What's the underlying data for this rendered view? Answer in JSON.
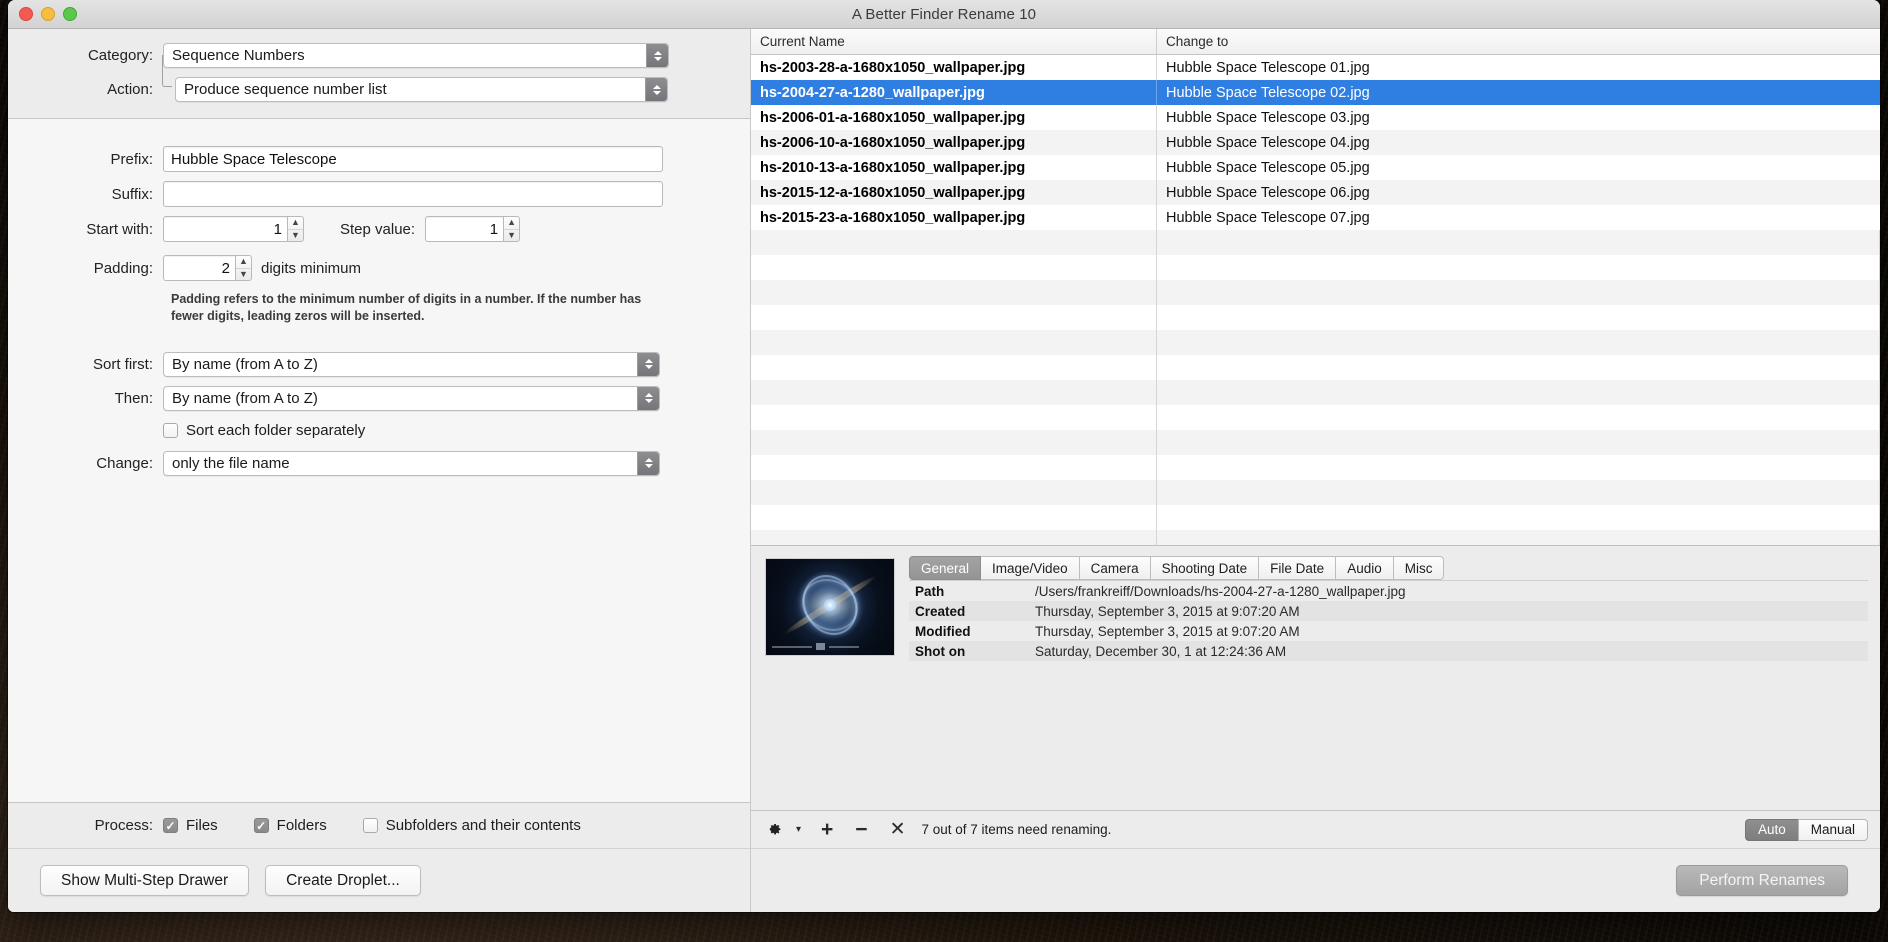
{
  "window": {
    "title": "A Better Finder Rename 10",
    "traffic": {
      "close": "close-button",
      "minimize": "minimize-button",
      "zoom": "zoom-button"
    }
  },
  "form": {
    "category_label": "Category:",
    "category_value": "Sequence Numbers",
    "action_label": "Action:",
    "action_value": "Produce sequence number list",
    "prefix_label": "Prefix:",
    "prefix_value": "Hubble Space Telescope",
    "prefix_placeholder": "",
    "suffix_label": "Suffix:",
    "suffix_value": "",
    "suffix_placeholder": "",
    "start_label": "Start with:",
    "start_value": "1",
    "step_label": "Step value:",
    "step_value": "1",
    "padding_label": "Padding:",
    "padding_value": "2",
    "padding_suffix": "digits minimum",
    "padding_help": "Padding refers to the minimum number of digits in a number. If the number has fewer digits, leading zeros will be inserted.",
    "sort_first_label": "Sort first:",
    "sort_first_value": "By name (from A to Z)",
    "then_label": "Then:",
    "then_value": "By name (from A to Z)",
    "sort_folder_label": "Sort each folder separately",
    "sort_folder_checked": false,
    "change_label": "Change:",
    "change_value": "only the file name",
    "stepper_up": "▲",
    "stepper_down": "▼"
  },
  "process": {
    "label": "Process:",
    "files_label": "Files",
    "files_checked": true,
    "folders_label": "Folders",
    "folders_checked": true,
    "subfolders_label": "Subfolders and their contents",
    "subfolders_checked": false
  },
  "footer": {
    "show_drawer_label": "Show Multi-Step Drawer",
    "create_droplet_label": "Create Droplet...",
    "perform_label": "Perform Renames"
  },
  "filelist": {
    "columns": [
      "Current Name",
      "Change to"
    ],
    "rows": [
      {
        "current": "hs-2003-28-a-1680x1050_wallpaper.jpg",
        "change": "Hubble Space Telescope 01.jpg",
        "selected": false
      },
      {
        "current": "hs-2004-27-a-1280_wallpaper.jpg",
        "change": "Hubble Space Telescope 02.jpg",
        "selected": true
      },
      {
        "current": "hs-2006-01-a-1680x1050_wallpaper.jpg",
        "change": "Hubble Space Telescope 03.jpg",
        "selected": false
      },
      {
        "current": "hs-2006-10-a-1680x1050_wallpaper.jpg",
        "change": "Hubble Space Telescope 04.jpg",
        "selected": false
      },
      {
        "current": "hs-2010-13-a-1680x1050_wallpaper.jpg",
        "change": "Hubble Space Telescope 05.jpg",
        "selected": false
      },
      {
        "current": "hs-2015-12-a-1680x1050_wallpaper.jpg",
        "change": "Hubble Space Telescope 06.jpg",
        "selected": false
      },
      {
        "current": "hs-2015-23-a-1680x1050_wallpaper.jpg",
        "change": "Hubble Space Telescope 07.jpg",
        "selected": false
      }
    ],
    "empty_row_count": 13
  },
  "info": {
    "tabs": [
      "General",
      "Image/Video",
      "Camera",
      "Shooting Date",
      "File Date",
      "Audio",
      "Misc"
    ],
    "active_tab": "General",
    "fields": [
      {
        "key": "Path",
        "value": "/Users/frankreiff/Downloads/hs-2004-27-a-1280_wallpaper.jpg"
      },
      {
        "key": "Created",
        "value": "Thursday, September 3, 2015 at 9:07:20 AM"
      },
      {
        "key": "Modified",
        "value": "Thursday, September 3, 2015 at 9:07:20 AM"
      },
      {
        "key": "Shot on",
        "value": "Saturday, December 30, 1 at 12:24:36 AM"
      }
    ],
    "thumbnail_name": "nebula-thumbnail"
  },
  "toolbar": {
    "gear_label": "⚙",
    "gear_caret": "▾",
    "add_label": "+",
    "remove_label": "−",
    "clear_label": "✕",
    "status": "7 out of 7 items need renaming.",
    "mode_auto": "Auto",
    "mode_manual": "Manual",
    "mode_selected": "Auto"
  },
  "colors": {
    "selection_blue": "#2f7fe3",
    "window_bg": "#ececec",
    "panel_bg": "#f6f6f6"
  }
}
